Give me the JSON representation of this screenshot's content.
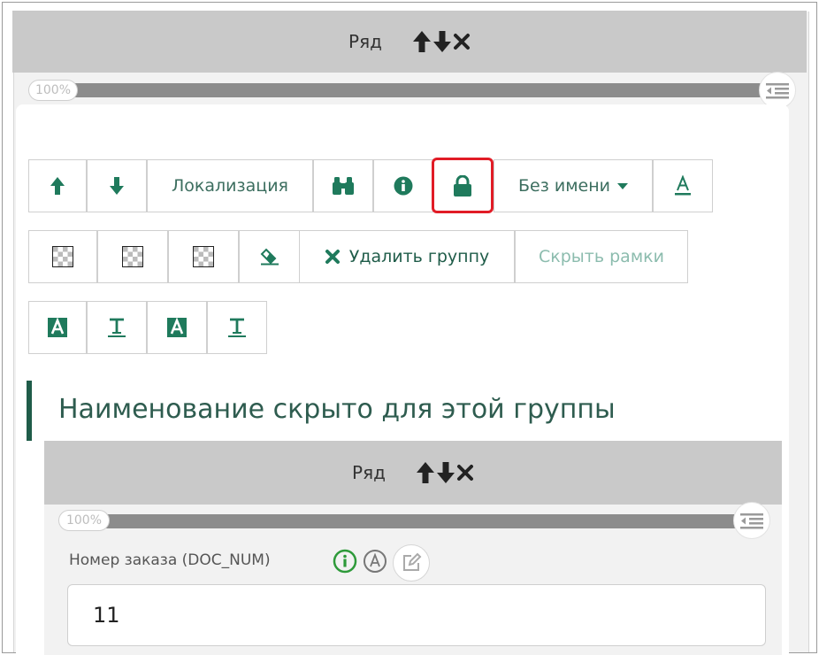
{
  "row_title": "Ряд",
  "progress_label": "100%",
  "toolbar_row1": {
    "localization_label": "Локализация",
    "name_dropdown_label": "Без имени"
  },
  "toolbar_row2": {
    "delete_group_label": "Удалить группу",
    "hide_borders_label": "Скрыть рамки"
  },
  "section_title": "Наименование скрыто для этой группы",
  "inner_row_title": "Ряд",
  "inner_progress_label": "100%",
  "field": {
    "label": "Номер заказа (DOC_NUM)",
    "value": "11"
  },
  "colors": {
    "accent": "#1f7a5c",
    "highlight": "#e11c26",
    "header_bg": "#c9c9c9"
  },
  "icons": [
    "arrow-up-icon",
    "arrow-down-icon",
    "close-icon",
    "list-indent-icon",
    "binoculars-icon",
    "info-icon",
    "lock-icon",
    "caret-down-icon",
    "text-color-icon",
    "checker-icon",
    "eraser-icon",
    "font-highlight-icon",
    "text-underline-icon",
    "info-circle-icon",
    "a-circle-icon",
    "edit-icon"
  ]
}
